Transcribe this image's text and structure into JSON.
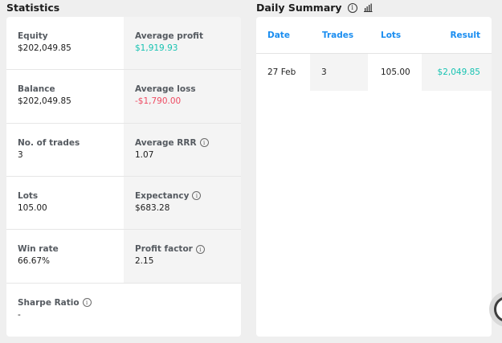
{
  "statistics": {
    "title": "Statistics",
    "items": [
      {
        "label": "Equity",
        "value": "$202,049.85"
      },
      {
        "label": "Average profit",
        "value": "$1,919.93",
        "tone": "positive"
      },
      {
        "label": "Balance",
        "value": "$202,049.85"
      },
      {
        "label": "Average loss",
        "value": "-$1,790.00",
        "tone": "negative"
      },
      {
        "label": "No. of trades",
        "value": "3"
      },
      {
        "label": "Average RRR",
        "value": "1.07",
        "info": true
      },
      {
        "label": "Lots",
        "value": "105.00"
      },
      {
        "label": "Expectancy",
        "value": "$683.28",
        "info": true
      },
      {
        "label": "Win rate",
        "value": "66.67%"
      },
      {
        "label": "Profit factor",
        "value": "2.15",
        "info": true
      },
      {
        "label": "Sharpe Ratio",
        "value": "-",
        "info": true
      }
    ]
  },
  "daily_summary": {
    "title": "Daily Summary",
    "columns": [
      "Date",
      "Trades",
      "Lots",
      "Result"
    ],
    "rows": [
      {
        "date": "27 Feb",
        "trades": "3",
        "lots": "105.00",
        "result": "$2,049.85"
      }
    ]
  },
  "icons": {
    "info": "info-circle-icon",
    "chart": "bar-chart-icon",
    "chat": "chat-bubble-icon"
  },
  "colors": {
    "positive": "#17c3b2",
    "negative": "#ee4a62",
    "header_accent": "#1a8df0"
  }
}
